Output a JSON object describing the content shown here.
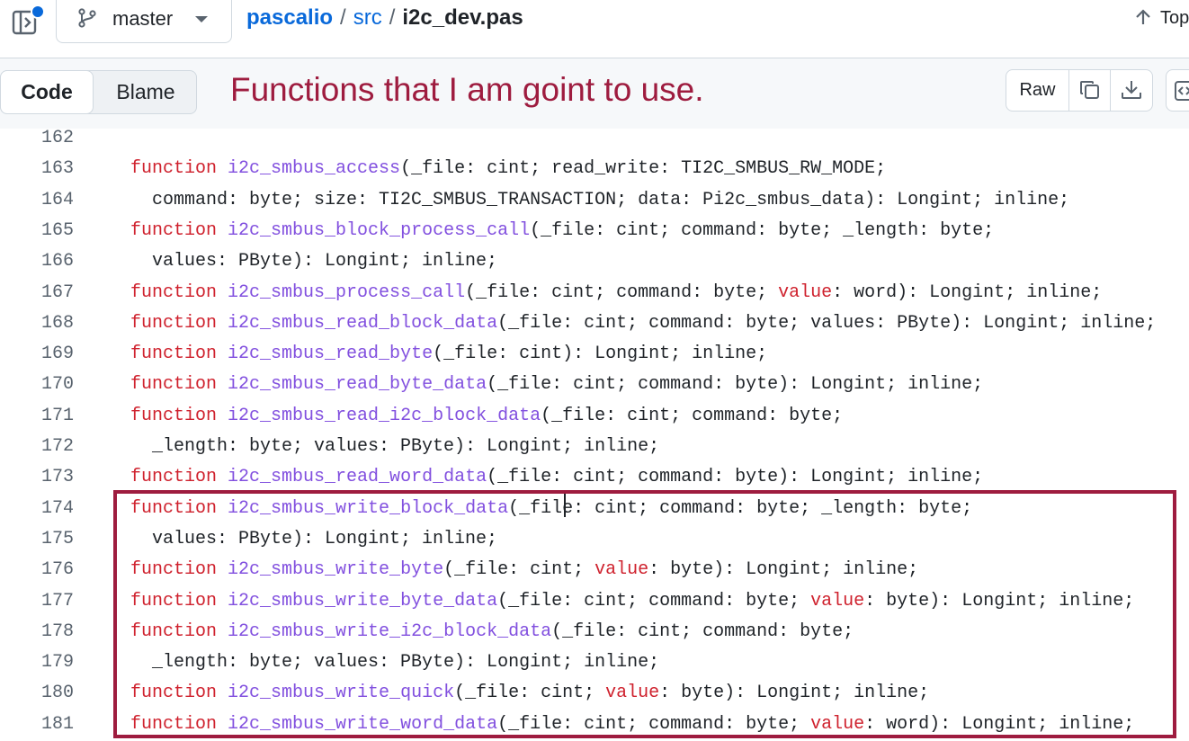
{
  "header": {
    "branch": "master",
    "breadcrumb": {
      "repo": "pascalio",
      "folder": "src",
      "file": "i2c_dev.pas",
      "separator": "/"
    },
    "top_label": "Top"
  },
  "toolbar": {
    "code_tab": "Code",
    "blame_tab": "Blame",
    "annotation": "Functions that I am goint to use.",
    "raw_label": "Raw"
  },
  "code_lines": [
    {
      "num": "162",
      "segs": []
    },
    {
      "num": "163",
      "segs": [
        [
          "kw",
          "function"
        ],
        [
          "t",
          " "
        ],
        [
          "fn",
          "i2c_smbus_access"
        ],
        [
          "t",
          "(_file: cint; read_write: TI2C_SMBUS_RW_MODE;"
        ]
      ]
    },
    {
      "num": "164",
      "cont": true,
      "segs": [
        [
          "t",
          "command: byte; size: TI2C_SMBUS_TRANSACTION; data: Pi2c_smbus_data): Longint; inline;"
        ]
      ]
    },
    {
      "num": "165",
      "segs": [
        [
          "kw",
          "function"
        ],
        [
          "t",
          " "
        ],
        [
          "fn",
          "i2c_smbus_block_process_call"
        ],
        [
          "t",
          "(_file: cint; command: byte; _length: byte;"
        ]
      ]
    },
    {
      "num": "166",
      "cont": true,
      "segs": [
        [
          "t",
          "values: PByte): Longint; inline;"
        ]
      ]
    },
    {
      "num": "167",
      "segs": [
        [
          "kw",
          "function"
        ],
        [
          "t",
          " "
        ],
        [
          "fn",
          "i2c_smbus_process_call"
        ],
        [
          "t",
          "(_file: cint; command: byte; "
        ],
        [
          "kw",
          "value"
        ],
        [
          "t",
          ": word): Longint; inline;"
        ]
      ]
    },
    {
      "num": "168",
      "segs": [
        [
          "kw",
          "function"
        ],
        [
          "t",
          " "
        ],
        [
          "fn",
          "i2c_smbus_read_block_data"
        ],
        [
          "t",
          "(_file: cint; command: byte; values: PByte): Longint; inline;"
        ]
      ]
    },
    {
      "num": "169",
      "segs": [
        [
          "kw",
          "function"
        ],
        [
          "t",
          " "
        ],
        [
          "fn",
          "i2c_smbus_read_byte"
        ],
        [
          "t",
          "(_file: cint): Longint; inline;"
        ]
      ]
    },
    {
      "num": "170",
      "segs": [
        [
          "kw",
          "function"
        ],
        [
          "t",
          " "
        ],
        [
          "fn",
          "i2c_smbus_read_byte_data"
        ],
        [
          "t",
          "(_file: cint; command: byte): Longint; inline;"
        ]
      ]
    },
    {
      "num": "171",
      "segs": [
        [
          "kw",
          "function"
        ],
        [
          "t",
          " "
        ],
        [
          "fn",
          "i2c_smbus_read_i2c_block_data"
        ],
        [
          "t",
          "(_file: cint; command: byte;"
        ]
      ]
    },
    {
      "num": "172",
      "cont": true,
      "segs": [
        [
          "t",
          "_length: byte; values: PByte): Longint; inline;"
        ]
      ]
    },
    {
      "num": "173",
      "segs": [
        [
          "kw",
          "function"
        ],
        [
          "t",
          " "
        ],
        [
          "fn",
          "i2c_smbus_read_word_data"
        ],
        [
          "t",
          "(_file: cint; command: byte): Longint; inline;"
        ]
      ]
    },
    {
      "num": "174",
      "segs": [
        [
          "kw",
          "function"
        ],
        [
          "t",
          " "
        ],
        [
          "fn",
          "i2c_smbus_write_block_data"
        ],
        [
          "t",
          "(_file: cint; command: byte; _length: byte;"
        ]
      ]
    },
    {
      "num": "175",
      "cont": true,
      "segs": [
        [
          "t",
          "values: PByte): Longint; inline;"
        ]
      ]
    },
    {
      "num": "176",
      "segs": [
        [
          "kw",
          "function"
        ],
        [
          "t",
          " "
        ],
        [
          "fn",
          "i2c_smbus_write_byte"
        ],
        [
          "t",
          "(_file: cint; "
        ],
        [
          "kw",
          "value"
        ],
        [
          "t",
          ": byte): Longint; inline;"
        ]
      ]
    },
    {
      "num": "177",
      "segs": [
        [
          "kw",
          "function"
        ],
        [
          "t",
          " "
        ],
        [
          "fn",
          "i2c_smbus_write_byte_data"
        ],
        [
          "t",
          "(_file: cint; command: byte; "
        ],
        [
          "kw",
          "value"
        ],
        [
          "t",
          ": byte): Longint; inline;"
        ]
      ]
    },
    {
      "num": "178",
      "segs": [
        [
          "kw",
          "function"
        ],
        [
          "t",
          " "
        ],
        [
          "fn",
          "i2c_smbus_write_i2c_block_data"
        ],
        [
          "t",
          "(_file: cint; command: byte;"
        ]
      ]
    },
    {
      "num": "179",
      "cont": true,
      "segs": [
        [
          "t",
          "_length: byte; values: PByte): Longint; inline;"
        ]
      ]
    },
    {
      "num": "180",
      "segs": [
        [
          "kw",
          "function"
        ],
        [
          "t",
          " "
        ],
        [
          "fn",
          "i2c_smbus_write_quick"
        ],
        [
          "t",
          "(_file: cint; "
        ],
        [
          "kw",
          "value"
        ],
        [
          "t",
          ": byte): Longint; inline;"
        ]
      ]
    },
    {
      "num": "181",
      "segs": [
        [
          "kw",
          "function"
        ],
        [
          "t",
          " "
        ],
        [
          "fn",
          "i2c_smbus_write_word_data"
        ],
        [
          "t",
          "(_file: cint; command: byte; "
        ],
        [
          "kw",
          "value"
        ],
        [
          "t",
          ": word): Longint; inline;"
        ]
      ]
    }
  ],
  "icons": {
    "panel_toggle": "sidebar-expand-icon",
    "branch": "git-branch-icon",
    "caret": "triangle-down-icon",
    "top": "arrow-up-icon",
    "copy": "copy-icon",
    "download": "download-icon",
    "embed": "code-square-icon"
  },
  "colors": {
    "annotation": "#9e1c3f",
    "keyword": "#cf222e",
    "function_name": "#8250df",
    "link": "#0969da"
  }
}
